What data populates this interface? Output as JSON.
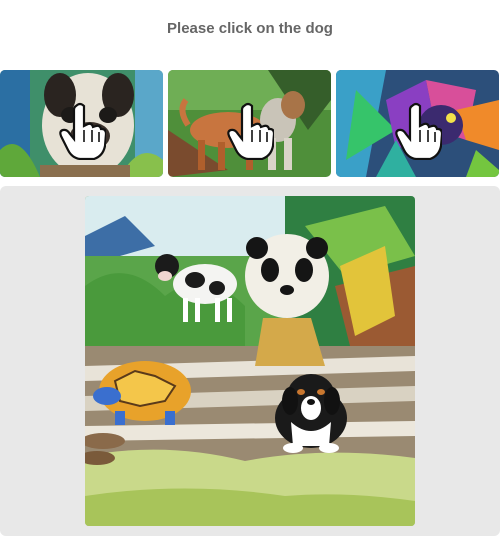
{
  "instruction": {
    "text": "Please click on the dog"
  },
  "examples": [
    {
      "subject": "pug",
      "icon": "pointer-hand-icon"
    },
    {
      "subject": "dog-walking",
      "icon": "pointer-hand-icon"
    },
    {
      "subject": "colorful-dog",
      "icon": "pointer-hand-icon"
    }
  ],
  "scene": {
    "animals": [
      "cow",
      "panda",
      "turtle",
      "dog"
    ]
  }
}
